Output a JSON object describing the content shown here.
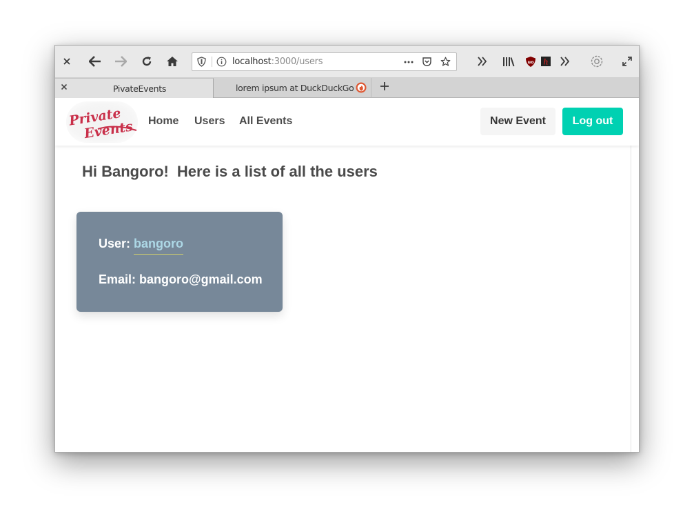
{
  "browser": {
    "url_host": "localhost",
    "url_path": ":3000/users",
    "tabs": [
      {
        "label": "PivateEvents",
        "active": true
      },
      {
        "label": "lorem ipsum at DuckDuckGo",
        "active": false
      }
    ],
    "icons": {
      "close": "close-icon",
      "back": "back-arrow-icon",
      "forward": "forward-arrow-icon",
      "reload": "reload-icon",
      "home": "home-icon",
      "shield": "tracking-shield-icon",
      "info": "info-icon",
      "more": "ellipsis-icon",
      "pocket": "pocket-icon",
      "bookmark": "star-icon",
      "overflow": "chevron-double-right-icon",
      "library": "library-icon",
      "ublock": "ublock-icon",
      "extension": "h-extension-icon",
      "settings": "gear-icon",
      "fullscreen": "expand-icon",
      "new_tab": "plus-icon"
    }
  },
  "navbar": {
    "logo_text_top": "Private",
    "logo_text_bottom": "Events",
    "links": [
      "Home",
      "Users",
      "All Events"
    ],
    "new_event_label": "New Event",
    "logout_label": "Log out"
  },
  "main": {
    "greeting_part1": "Hi Bangoro!",
    "greeting_part2": "Here is a list of all the users",
    "users": [
      {
        "user_label": "User:",
        "username": "bangoro",
        "email_label": "Email:",
        "email": "bangoro@gmail.com"
      }
    ]
  },
  "colors": {
    "accent": "#00d1b2",
    "card": "#778899",
    "link": "#add8e6",
    "logo": "#c9304a"
  }
}
